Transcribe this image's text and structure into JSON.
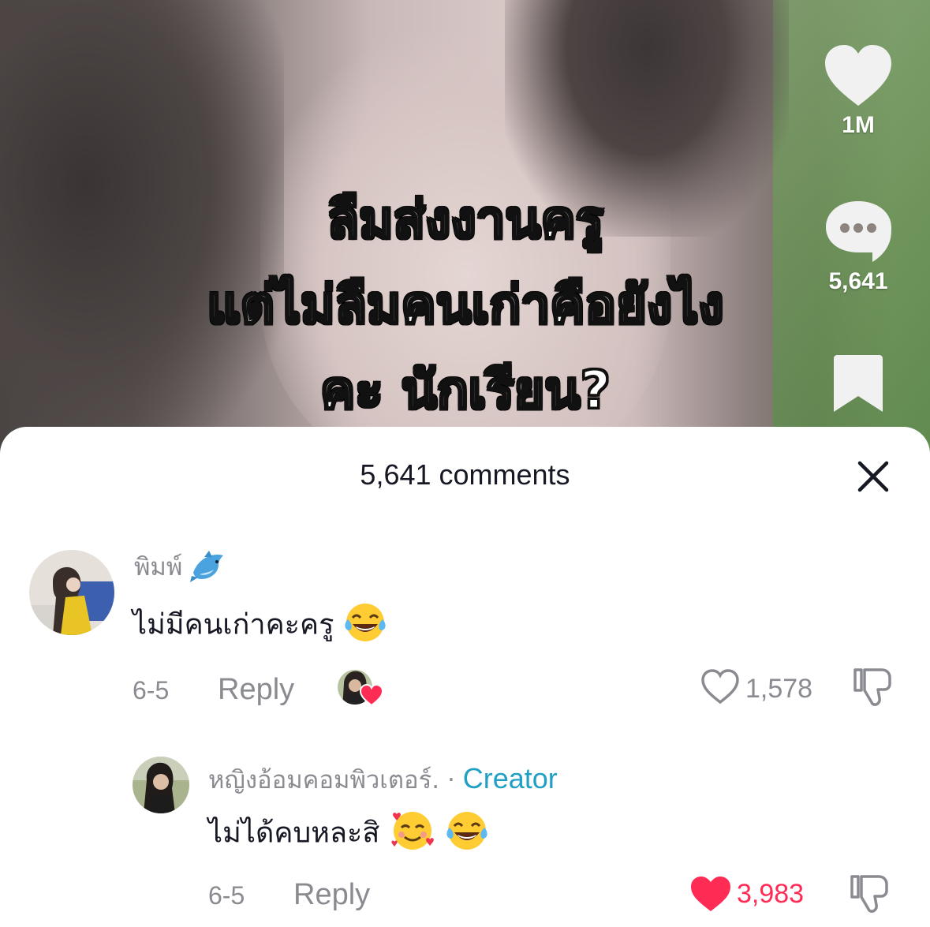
{
  "video": {
    "caption_lines": [
      "ลืมส่งงานครู",
      "แต่ไม่ลืมคนเก่าคือยังไง",
      "คะ นักเรียน?"
    ],
    "likes": "1M",
    "comments": "5,641"
  },
  "sheet": {
    "title": "5,641 comments"
  },
  "comments": [
    {
      "username": "พิมพ์",
      "username_emoji": "dolphin",
      "text": "ไม่มีคนเก่าคะครู",
      "text_emoji": "laughing-tears",
      "date": "6-5",
      "reply_label": "Reply",
      "likes": "1,578",
      "liked_by_creator": true
    },
    {
      "username": "หญิงอ้อมคอมพิวเตอร์.",
      "separator": "·",
      "badge": "Creator",
      "text": "ไม่ได้คบหละสิ",
      "text_emojis": [
        "smiling-with-hearts",
        "laughing-tears"
      ],
      "date": "6-5",
      "reply_label": "Reply",
      "likes": "3,983",
      "liked": true
    }
  ],
  "colors": {
    "liked_red": "#fe2c55",
    "creator_blue": "#20a0c4",
    "muted_gray": "#8a8b91",
    "text_dark": "#161823"
  }
}
